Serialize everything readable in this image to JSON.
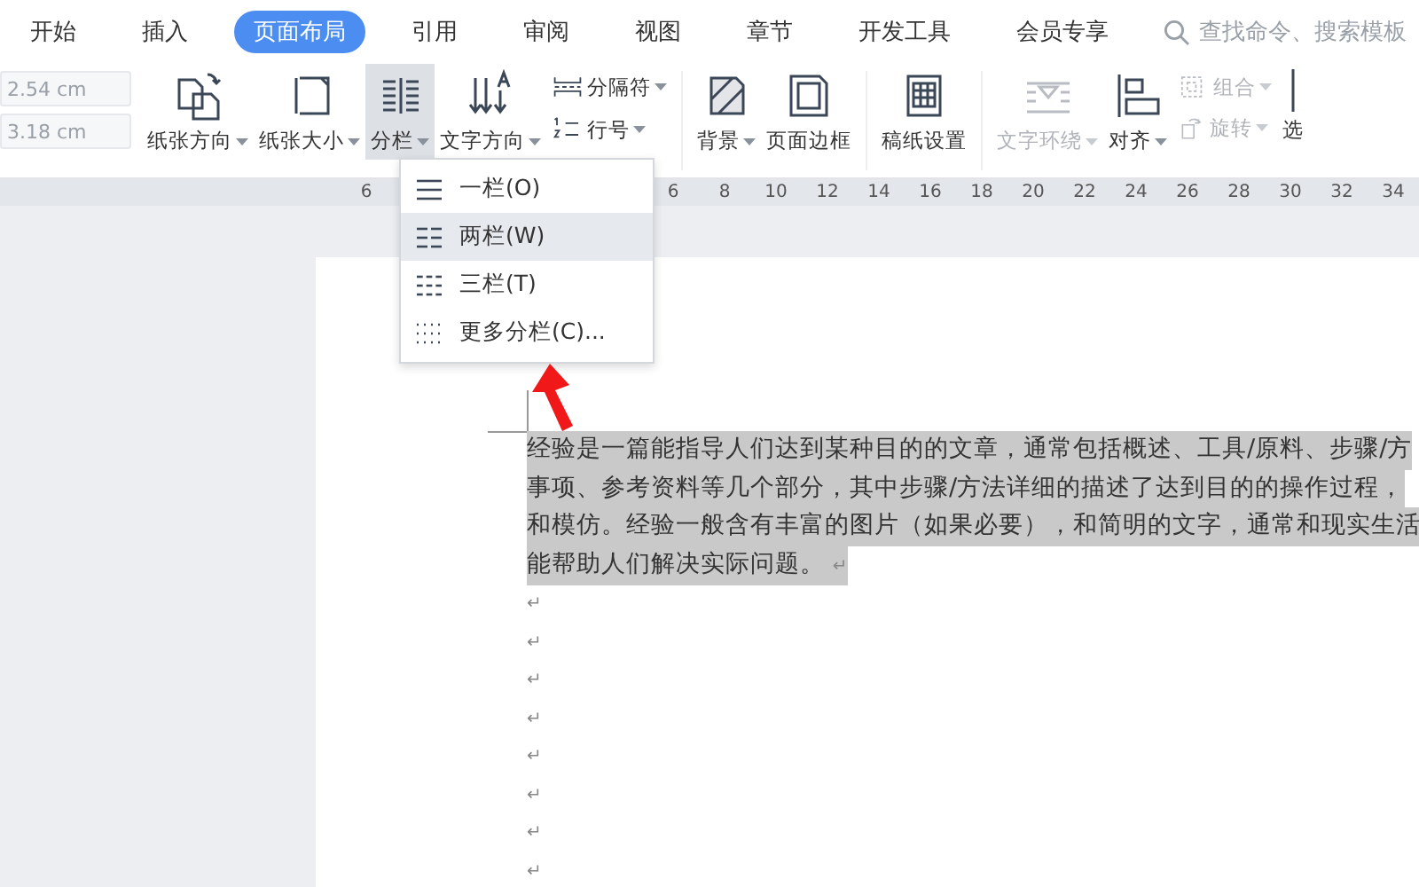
{
  "tabs": [
    {
      "label": "开始",
      "selected": false
    },
    {
      "label": "插入",
      "selected": false
    },
    {
      "label": "页面布局",
      "selected": true
    },
    {
      "label": "引用",
      "selected": false
    },
    {
      "label": "审阅",
      "selected": false
    },
    {
      "label": "视图",
      "selected": false
    },
    {
      "label": "章节",
      "selected": false
    },
    {
      "label": "开发工具",
      "selected": false
    },
    {
      "label": "会员专享",
      "selected": false
    }
  ],
  "search": {
    "placeholder": "查找命令、搜索模板"
  },
  "margin_fields": [
    {
      "value": "2.54 cm"
    },
    {
      "value": "3.18 cm"
    }
  ],
  "ribbon": [
    {
      "kind": "large",
      "label": "纸张方向",
      "dropdown": true,
      "disabled": false,
      "selected": false
    },
    {
      "kind": "large",
      "label": "纸张大小",
      "dropdown": true,
      "disabled": false,
      "selected": false
    },
    {
      "kind": "large",
      "label": "分栏",
      "dropdown": true,
      "disabled": false,
      "selected": true
    },
    {
      "kind": "large",
      "label": "文字方向",
      "dropdown": true,
      "disabled": false,
      "selected": false
    },
    {
      "kind": "stack",
      "items": [
        {
          "label": "分隔符",
          "dropdown": true,
          "disabled": false
        },
        {
          "label": "行号",
          "dropdown": true,
          "disabled": false
        }
      ]
    },
    {
      "kind": "separator"
    },
    {
      "kind": "large",
      "label": "背景",
      "dropdown": true,
      "disabled": false,
      "selected": false
    },
    {
      "kind": "large",
      "label": "页面边框",
      "dropdown": false,
      "disabled": false,
      "selected": false
    },
    {
      "kind": "separator"
    },
    {
      "kind": "large",
      "label": "稿纸设置",
      "dropdown": false,
      "disabled": false,
      "selected": false
    },
    {
      "kind": "separator"
    },
    {
      "kind": "large",
      "label": "文字环绕",
      "dropdown": true,
      "disabled": true,
      "selected": false
    },
    {
      "kind": "large",
      "label": "对齐",
      "dropdown": true,
      "disabled": false,
      "selected": false
    },
    {
      "kind": "stack",
      "items": [
        {
          "label": "组合",
          "dropdown": true,
          "disabled": true
        },
        {
          "label": "旋转",
          "dropdown": true,
          "disabled": true
        }
      ]
    },
    {
      "kind": "large",
      "label": "选",
      "dropdown": false,
      "disabled": false,
      "selected": false
    }
  ],
  "ruler": {
    "first": "6",
    "numbers": [
      "6",
      "8",
      "10",
      "12",
      "14",
      "16",
      "18",
      "20",
      "22",
      "24",
      "26",
      "28",
      "30",
      "32",
      "34"
    ]
  },
  "column_menu": [
    {
      "kind": "one",
      "label": "一栏(O)",
      "selected": false
    },
    {
      "kind": "two",
      "label": "两栏(W)",
      "selected": true
    },
    {
      "kind": "three",
      "label": "三栏(T)",
      "selected": false
    },
    {
      "kind": "more",
      "label": "更多分栏(C)...",
      "selected": false
    }
  ],
  "document": {
    "lines": [
      "经验是一篇能指导人们达到某种目的的文章，通常包括概述、工具/原料、步骤/方",
      "事项、参考资料等几个部分，其中步骤/方法详细的描述了达到目的的操作过程，",
      "和模仿。经验一般含有丰富的图片（如果必要），和简明的文字，通常和现实生活",
      "能帮助人们解决实际问题。"
    ],
    "end_mark": "↵",
    "empty_paragraph_marks": [
      "↵",
      "↵",
      "↵",
      "↵",
      "↵",
      "↵",
      "↵",
      "↵"
    ]
  }
}
